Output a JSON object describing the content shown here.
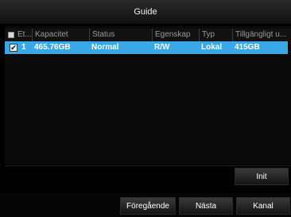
{
  "window": {
    "title": "Guide"
  },
  "table": {
    "columns": [
      "Et...",
      "Kapacitet",
      "Status",
      "Egenskap",
      "Typ",
      "Tillgängligt u..."
    ],
    "rows": [
      {
        "checked": true,
        "index": "1",
        "capacity": "465.76GB",
        "status": "Normal",
        "property": "R/W",
        "type": "Lokal",
        "available": "415GB"
      }
    ]
  },
  "buttons": {
    "init": "Init",
    "previous": "Föregående",
    "next": "Nästa",
    "channel": "Kanal"
  },
  "icons": {
    "checkmark": "✔"
  }
}
